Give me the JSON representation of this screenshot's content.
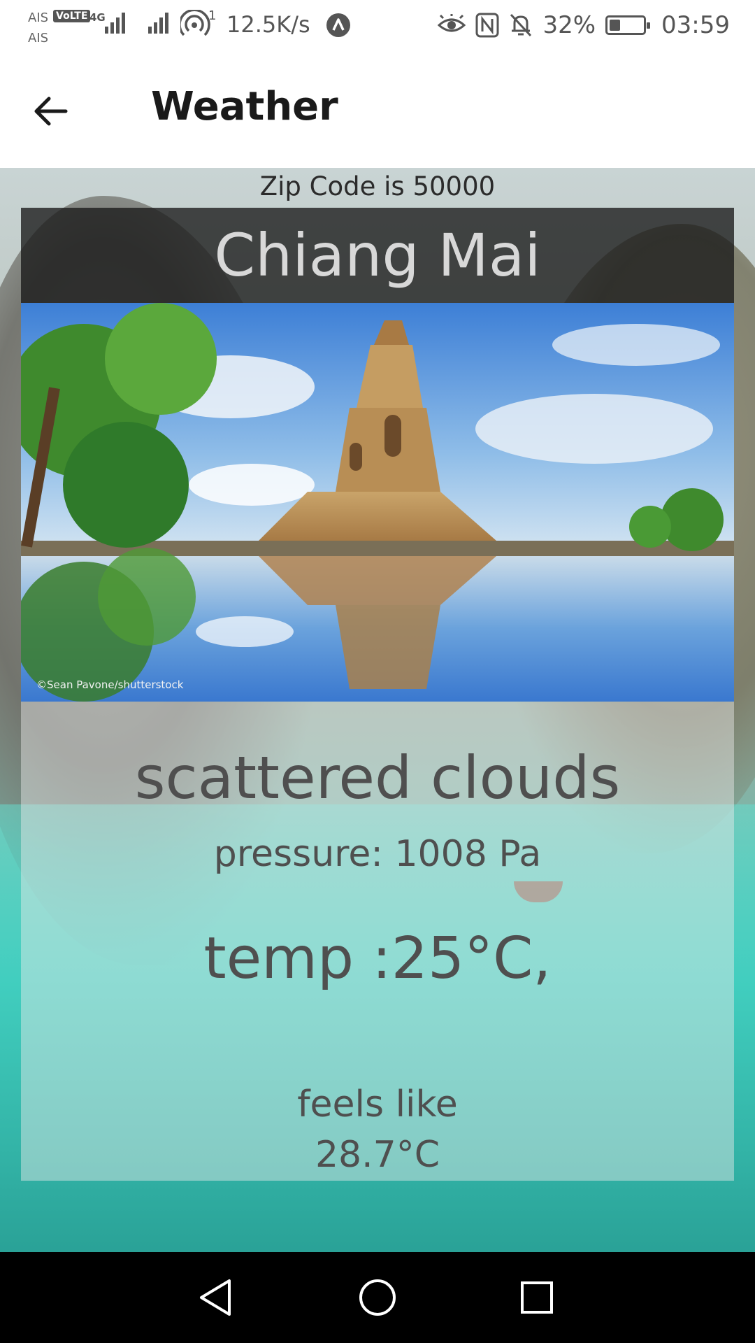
{
  "status_bar": {
    "carrier_1": "AIS",
    "carrier_2": "AIS",
    "volte": "VoLTE",
    "network": "4G",
    "hotspot_count": "1",
    "speed": "12.5K/s",
    "battery": "32%",
    "battery_level": 0.32,
    "time": "03:59",
    "icons": [
      "signal-icon",
      "hotspot-icon",
      "app-notification-icon",
      "eye-comfort-icon",
      "nfc-icon",
      "bell-off-icon",
      "battery-icon"
    ]
  },
  "app_bar": {
    "title": "Weather",
    "back_icon": "arrow-left-icon"
  },
  "main": {
    "zip_text": "Zip Code is 50000",
    "city": "Chiang Mai",
    "photo_credit": "©Sean Pavone/shutterstock",
    "description": "scattered clouds",
    "pressure": "pressure: 1008 Pa",
    "temp": "temp :25°C,",
    "feels_label": "feels like",
    "feels_value": "28.7°C"
  },
  "nav_bar": {
    "icons": [
      "back-triangle-icon",
      "home-circle-icon",
      "recents-square-icon"
    ]
  },
  "colors": {
    "city_bar": "#191919",
    "text": "#4f4f4f",
    "nav": "#000000"
  }
}
